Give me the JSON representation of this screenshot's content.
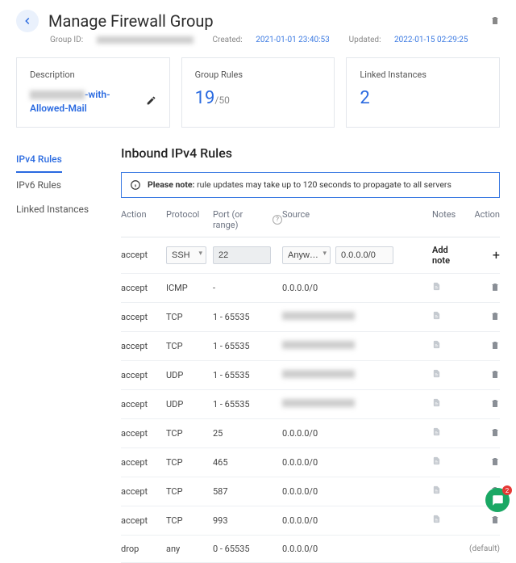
{
  "header": {
    "title": "Manage Firewall Group",
    "group_id_label": "Group ID:",
    "created_label": "Created:",
    "created_date": "2021-01-01 23:40:53",
    "updated_label": "Updated:",
    "updated_date": "2022-01-15 02:29:25"
  },
  "cards": {
    "description": {
      "title": "Description",
      "suffix": "-with-",
      "line2": "Allowed-Mail"
    },
    "group_rules": {
      "title": "Group Rules",
      "count": "19",
      "max": "/50"
    },
    "linked": {
      "title": "Linked Instances",
      "count": "2"
    }
  },
  "sidebar": {
    "tabs": [
      "IPv4 Rules",
      "IPv6 Rules",
      "Linked Instances"
    ]
  },
  "main": {
    "title": "Inbound IPv4 Rules",
    "note_bold": "Please note:",
    "note_text": " rule updates may take up to 120 seconds to propagate to all servers",
    "columns": {
      "action": "Action",
      "protocol": "Protocol",
      "port": "Port (or range)",
      "source": "Source",
      "notes": "Notes",
      "ract": "Action"
    },
    "input_row": {
      "action": "accept",
      "protocol": "SSH",
      "port": "22",
      "source_mode": "Anyw…",
      "source_ip": "0.0.0.0/0",
      "add_note": "Add note"
    },
    "rows": [
      {
        "action": "accept",
        "proto": "ICMP",
        "port": "-",
        "source": "0.0.0.0/0",
        "blur": false
      },
      {
        "action": "accept",
        "proto": "TCP",
        "port": "1 - 65535",
        "source": "",
        "blur": true
      },
      {
        "action": "accept",
        "proto": "TCP",
        "port": "1 - 65535",
        "source": "",
        "blur": true
      },
      {
        "action": "accept",
        "proto": "UDP",
        "port": "1 - 65535",
        "source": "",
        "blur": true
      },
      {
        "action": "accept",
        "proto": "UDP",
        "port": "1 - 65535",
        "source": "",
        "blur": true
      },
      {
        "action": "accept",
        "proto": "TCP",
        "port": "25",
        "source": "0.0.0.0/0",
        "blur": false
      },
      {
        "action": "accept",
        "proto": "TCP",
        "port": "465",
        "source": "0.0.0.0/0",
        "blur": false
      },
      {
        "action": "accept",
        "proto": "TCP",
        "port": "587",
        "source": "0.0.0.0/0",
        "blur": false
      },
      {
        "action": "accept",
        "proto": "TCP",
        "port": "993",
        "source": "0.0.0.0/0",
        "blur": false
      }
    ],
    "last_row": {
      "action": "drop",
      "proto": "any",
      "port": "0 - 65535",
      "source": "0.0.0.0/0",
      "suffix": "(default)"
    }
  },
  "chat_badge": "2"
}
